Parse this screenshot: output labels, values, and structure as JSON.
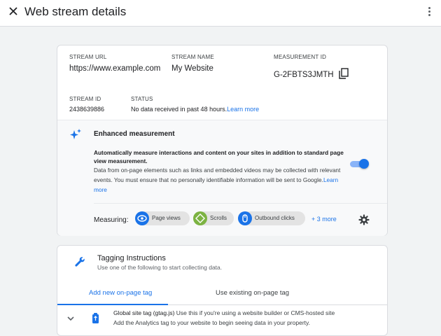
{
  "header": {
    "title": "Web stream details",
    "close_icon": "close-icon",
    "menu_icon": "more-vert-icon"
  },
  "stream": {
    "url_label": "STREAM URL",
    "url": "https://www.example.com",
    "name_label": "STREAM NAME",
    "name": "My Website",
    "measurement_id_label": "MEASUREMENT ID",
    "measurement_id": "G-2FBTS3JMTH",
    "id_label": "STREAM ID",
    "id": "2438639886",
    "status_label": "STATUS",
    "status": "No data received in past 48 hours.",
    "status_link": "Learn more"
  },
  "enhanced": {
    "title": "Enhanced measurement",
    "bold_desc": "Automatically measure interactions and content on your sites in addition to standard page view measurement.",
    "desc": "Data from on-page elements such as links and embedded videos may be collected with relevant events. You must ensure that no personally identifiable information will be sent to Google.",
    "desc_link": "Learn more",
    "toggle_on": true,
    "measuring_label": "Measuring:",
    "chips": [
      {
        "label": "Page views",
        "icon": "eye-icon",
        "color": "#1a73e8"
      },
      {
        "label": "Scrolls",
        "icon": "scroll-diamond-icon",
        "color": "#7cb342"
      },
      {
        "label": "Outbound clicks",
        "icon": "mouse-icon",
        "color": "#1a73e8"
      }
    ],
    "more": "+ 3 more"
  },
  "tagging": {
    "title": "Tagging Instructions",
    "subtitle": "Use one of the following to start collecting data.",
    "tabs": [
      "Add new on-page tag",
      "Use existing on-page tag"
    ],
    "active_tab": 0,
    "option_title": "Global site tag (gtag.js)",
    "option_desc": " Use this if you're using a website builder or CMS-hosted site",
    "option_desc2": "Add the Analytics tag to your website to begin seeing data in your property."
  },
  "colors": {
    "accent": "#1a73e8",
    "background": "#f1f3f4"
  }
}
